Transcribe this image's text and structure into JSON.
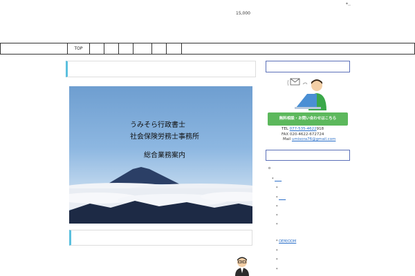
{
  "header": {
    "number": "15,000",
    "corner_mark": "*‥"
  },
  "nav": {
    "items": [
      "TOP",
      "",
      "",
      "",
      "",
      "",
      ""
    ]
  },
  "hero": {
    "line1": "うみそら行政書士",
    "line2": "社会保険労務士事務所",
    "line3": "総合業務案内"
  },
  "sidebar": {
    "consult_button": "無料相談・お問い合わせはこちら",
    "tel_label": "TEL",
    "tel_link": "077-535-4622",
    "tel_rest": "918",
    "fax": "FAX 020-4622-672724",
    "mail_label": "Mail",
    "mail_link": "umisora76@gmail.com",
    "circle_item": "o",
    "items": [
      {
        "bullet": "*",
        "text": "____",
        "link": true
      },
      {
        "bullet": "*",
        "text": "",
        "link": false
      },
      {
        "bullet": "*",
        "text": "____",
        "link": true
      },
      {
        "bullet": "*",
        "text": "",
        "link": false
      },
      {
        "bullet": "*",
        "text": "",
        "link": false
      },
      {
        "bullet": "*",
        "text": "",
        "link": false
      },
      {
        "bullet": "*",
        "text": "OEM/ODM",
        "link": true
      },
      {
        "bullet": "*",
        "text": "",
        "link": false
      },
      {
        "bullet": "*",
        "text": "",
        "link": false
      },
      {
        "bullet": "*",
        "text": "",
        "link": false
      }
    ]
  },
  "colors": {
    "accent": "#5bc0de",
    "button": "#5cb85c",
    "link": "#2a6fc9",
    "sidebar_border": "#5a6fb8"
  },
  "icons": [
    "person-laptop-icon",
    "mail-icon",
    "businessman-icon"
  ]
}
